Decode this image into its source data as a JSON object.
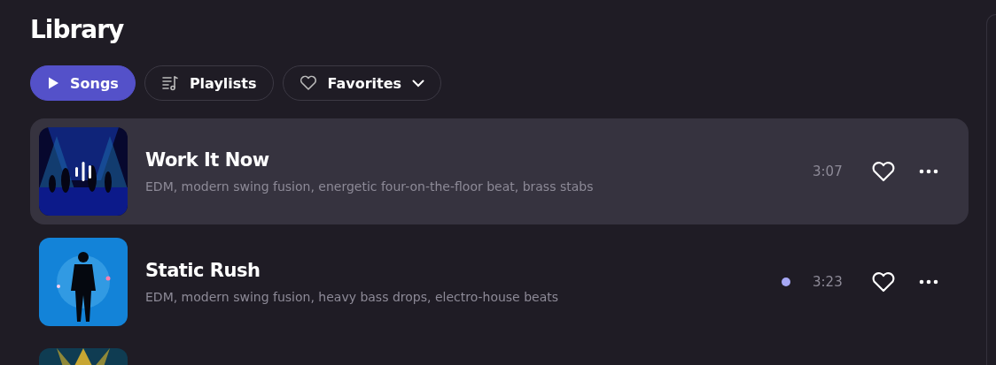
{
  "title": "Library",
  "tabs": [
    {
      "label": "Songs",
      "selected": true,
      "dropdown": false
    },
    {
      "label": "Playlists",
      "selected": false,
      "dropdown": false
    },
    {
      "label": "Favorites",
      "selected": false,
      "dropdown": true
    }
  ],
  "songs": [
    {
      "title": "Work It Now",
      "description": "EDM, modern swing fusion, energetic four-on-the-floor beat, brass stabs",
      "duration": "3:07",
      "selected": true,
      "playing": true,
      "marked": false
    },
    {
      "title": "Static Rush",
      "description": "EDM, modern swing fusion, heavy bass drops, electro-house beats",
      "duration": "3:23",
      "selected": false,
      "playing": false,
      "marked": true
    },
    {
      "selected": false
    }
  ]
}
